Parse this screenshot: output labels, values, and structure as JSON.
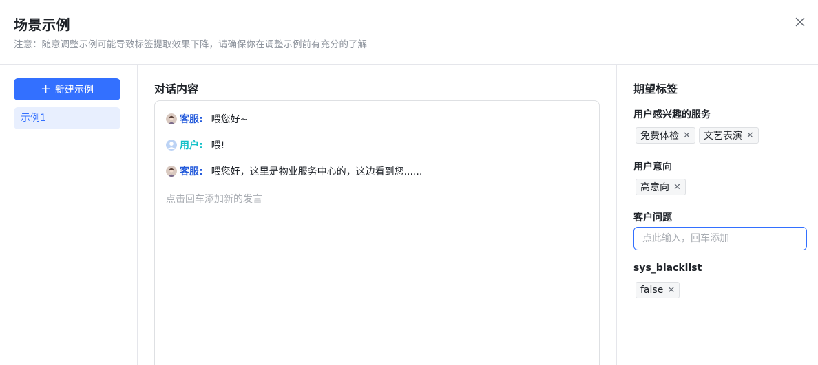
{
  "dialog": {
    "title": "场景示例",
    "notice": "注意：随意调整示例可能导致标签提取效果下降，请确保你在调整示例前有充分的了解",
    "close_icon": "close-icon"
  },
  "sidebar": {
    "new_button_label": "新建示例",
    "new_button_icon": "plus-icon",
    "items": [
      {
        "label": "示例1",
        "selected": true
      }
    ]
  },
  "conversation": {
    "title": "对话内容",
    "messages": [
      {
        "speaker": "客服:",
        "text": "喂您好~",
        "role": "agent"
      },
      {
        "speaker": "用户:",
        "text": "喂!",
        "role": "user"
      },
      {
        "speaker": "客服:",
        "text": "喂您好，这里是物业服务中心的，这边看到您......",
        "role": "agent"
      }
    ],
    "add_placeholder": "点击回车添加新的发言"
  },
  "labels": {
    "title": "期望标签",
    "groups": [
      {
        "name": "用户感兴趣的服务",
        "tags": [
          "免费体检",
          "文艺表演"
        ]
      },
      {
        "name": "用户意向",
        "tags": [
          "高意向"
        ]
      },
      {
        "name": "客户问题",
        "input_placeholder": "点此输入，回车添加",
        "input_value": ""
      },
      {
        "name": "sys_blacklist",
        "tags": [
          "false"
        ]
      }
    ]
  },
  "colors": {
    "primary": "#3370ff",
    "agent_speaker": "#245bdb",
    "user_speaker": "#14c0c8",
    "selected_bg": "#e8effe"
  }
}
